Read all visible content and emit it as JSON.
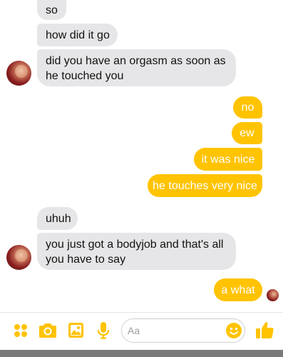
{
  "conversation": {
    "messages": [
      {
        "side": "in",
        "text": "so"
      },
      {
        "side": "in",
        "text": "how did it go"
      },
      {
        "side": "in",
        "line1": "did you have an orgasm as soon as",
        "line2": "he touched you"
      },
      {
        "side": "out",
        "text": "no"
      },
      {
        "side": "out",
        "text": "ew"
      },
      {
        "side": "out",
        "text": "it was nice"
      },
      {
        "side": "out",
        "text": "he touches very nice"
      },
      {
        "side": "in",
        "text": "uhuh"
      },
      {
        "side": "in",
        "line1": "you just got a bodyjob and that's all",
        "line2": "you have to say"
      },
      {
        "side": "out",
        "text": "a what"
      }
    ]
  },
  "composer": {
    "placeholder": "Aa",
    "icons": [
      "more-apps-icon",
      "camera-icon",
      "gallery-icon",
      "microphone-icon",
      "emoji-icon",
      "thumbs-up-icon"
    ]
  },
  "colors": {
    "outgoing_bubble": "#ffc300",
    "incoming_bubble": "#e6e6e8",
    "accent": "#ffc300"
  }
}
